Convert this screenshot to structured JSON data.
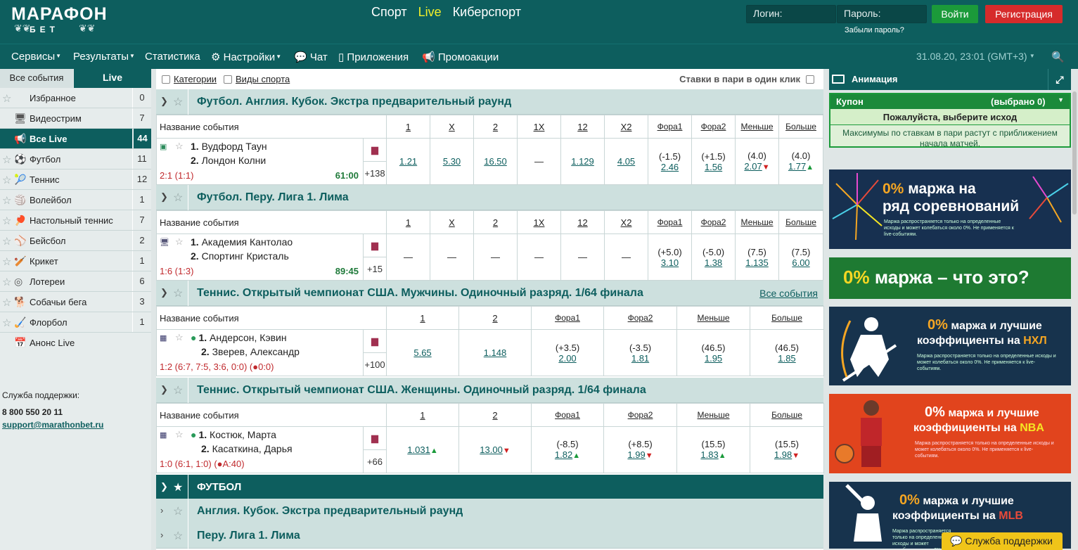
{
  "logo": {
    "line1": "МАРАФОН",
    "line2": "БЕТ"
  },
  "topnav": [
    "Спорт",
    "Live",
    "Киберспорт"
  ],
  "auth": {
    "login_placeholder": "Логин:",
    "password_placeholder": "Пароль:",
    "login_button": "Войти",
    "register_button": "Регистрация",
    "forgot": "Забыли пароль?"
  },
  "menu": {
    "services": "Сервисы",
    "results": "Результаты",
    "stats": "Статистика",
    "settings": "Настройки",
    "chat": "Чат",
    "apps": "Приложения",
    "promo": "Промоакции",
    "clock": "31.08.20, 23:01 (GMT+3)"
  },
  "sidebar": {
    "tab_all": "Все события",
    "tab_live": "Live",
    "items": [
      {
        "label": "Избранное",
        "count": "0"
      },
      {
        "label": "Видеострим",
        "count": "7"
      },
      {
        "label": "Все Live",
        "count": "44"
      },
      {
        "label": "Футбол",
        "count": "11"
      },
      {
        "label": "Теннис",
        "count": "12"
      },
      {
        "label": "Волейбол",
        "count": "1"
      },
      {
        "label": "Настольный теннис",
        "count": "7"
      },
      {
        "label": "Бейсбол",
        "count": "2"
      },
      {
        "label": "Крикет",
        "count": "1"
      },
      {
        "label": "Лотереи",
        "count": "6"
      },
      {
        "label": "Собачьи бега",
        "count": "3"
      },
      {
        "label": "Флорбол",
        "count": "1"
      },
      {
        "label": "Анонс Live",
        "count": ""
      }
    ],
    "support_label": "Служба поддержки:",
    "support_phone": "8 800 550 20 11",
    "support_email": "support@marathonbet.ru"
  },
  "filters": {
    "categories": "Категории",
    "sports": "Виды спорта",
    "one_click": "Ставки в пари в один клик"
  },
  "groups": [
    {
      "title": "Футбол. Англия. Кубок. Экстра предварительный раунд",
      "headers": [
        "Название события",
        "1",
        "X",
        "2",
        "1X",
        "12",
        "X2",
        "Фора1",
        "Фора2",
        "Меньше",
        "Больше"
      ],
      "event": {
        "team1": "Вудфорд Таун",
        "team2": "Лондон Колни",
        "score": "2:1 (1:1)",
        "time": "61:00",
        "more": "+138",
        "odds": [
          "1.21",
          "5.30",
          "16.50",
          "—",
          "1.129",
          "4.05"
        ],
        "h1": "(-1.5)",
        "h1v": "2.46",
        "h2": "(+1.5)",
        "h2v": "1.56",
        "lt": "(4.0)",
        "ltv": "2.07",
        "gt": "(4.0)",
        "gtv": "1.77"
      }
    },
    {
      "title": "Футбол. Перу. Лига 1. Лима",
      "headers": [
        "Название события",
        "1",
        "X",
        "2",
        "1X",
        "12",
        "X2",
        "Фора1",
        "Фора2",
        "Меньше",
        "Больше"
      ],
      "event": {
        "team1": "Академия Кантолао",
        "team2": "Спортинг Кристаль",
        "score": "1:6 (1:3)",
        "time": "89:45",
        "more": "+15",
        "odds": [
          "—",
          "—",
          "—",
          "—",
          "—",
          "—"
        ],
        "h1": "(+5.0)",
        "h1v": "3.10",
        "h2": "(-5.0)",
        "h2v": "1.38",
        "lt": "(7.5)",
        "ltv": "1.135",
        "gt": "(7.5)",
        "gtv": "6.00"
      }
    },
    {
      "title": "Теннис. Открытый чемпионат США. Мужчины. Одиночный разряд. 1/64 финала",
      "all_events": "Все события",
      "headers": [
        "Название события",
        "1",
        "2",
        "Фора1",
        "Фора2",
        "Меньше",
        "Больше"
      ],
      "event": {
        "team1": "Андерсон, Кэвин",
        "team2": "Зверев, Александр",
        "score": "1:2 (6:7, 7:5, 3:6, 0:0) (●0:0)",
        "more": "+100",
        "odds": [
          "5.65",
          "1.148"
        ],
        "h1": "(+3.5)",
        "h1v": "2.00",
        "h2": "(-3.5)",
        "h2v": "1.81",
        "lt": "(46.5)",
        "ltv": "1.95",
        "gt": "(46.5)",
        "gtv": "1.85"
      }
    },
    {
      "title": "Теннис. Открытый чемпионат США. Женщины. Одиночный разряд. 1/64 финала",
      "headers": [
        "Название события",
        "1",
        "2",
        "Фора1",
        "Фора2",
        "Меньше",
        "Больше"
      ],
      "event": {
        "team1": "Костюк, Марта",
        "team2": "Касаткина, Дарья",
        "score": "1:0 (6:1, 1:0) (●A:40)",
        "more": "+66",
        "odds": [
          "1.031",
          "13.00"
        ],
        "h1": "(-8.5)",
        "h1v": "1.82",
        "h2": "(+8.5)",
        "h2v": "1.99",
        "lt": "(15.5)",
        "ltv": "1.83",
        "gt": "(15.5)",
        "gtv": "1.98"
      }
    }
  ],
  "football_section": {
    "title": "ФУТБОЛ",
    "sub1": "Англия. Кубок. Экстра предварительный раунд",
    "sub2": "Перу. Лига 1. Лима"
  },
  "right": {
    "animation": "Анимация",
    "coupon": "Купон",
    "selected": "(выбрано 0)",
    "choose": "Пожалуйста, выберите исход",
    "coupon_msg": "Максимумы по ставкам в пари растут с приближением начала матчей.",
    "b1_zero": "0%",
    "b1_title_a": "маржа на",
    "b1_title_b": "ряд соревнований",
    "b1_small": "Маржа распространяется только на определенные исходы и может колебаться около 0%. Не применяется к live-событиям.",
    "b2_zero": "0%",
    "b2_title": "маржа – что это?",
    "b3_zero": "0%",
    "b3_title_a": "маржа и лучшие",
    "b3_title_b": "коэффициенты на",
    "b3_hl": "НХЛ",
    "b3_small": "Маржа распространяется только на определенные исходы и может колебаться около 0%. Не применяется к live-событиям.",
    "b4_zero": "0%",
    "b4_title_a": "маржа и лучшие",
    "b4_title_b": "коэффициенты на",
    "b4_hl": "NBA",
    "b4_small": "Маржа распространяется только на определенные исходы и может колебаться около 0%. Не применяется к live-событиям.",
    "b5_zero": "0%",
    "b5_title_a": "маржа и лучшие",
    "b5_title_b": "коэффициенты на",
    "b5_hl": "MLB",
    "b5_small": "Маржа распространяется только на определенные исходы и может колебаться около 0%. Не применяется к live-событиям.",
    "support_button": "Служба поддержки"
  },
  "colors": {
    "brand": "#0d5e5e",
    "accent": "#f2ef2a",
    "green": "#1b9a3a",
    "red": "#d62b2b"
  }
}
